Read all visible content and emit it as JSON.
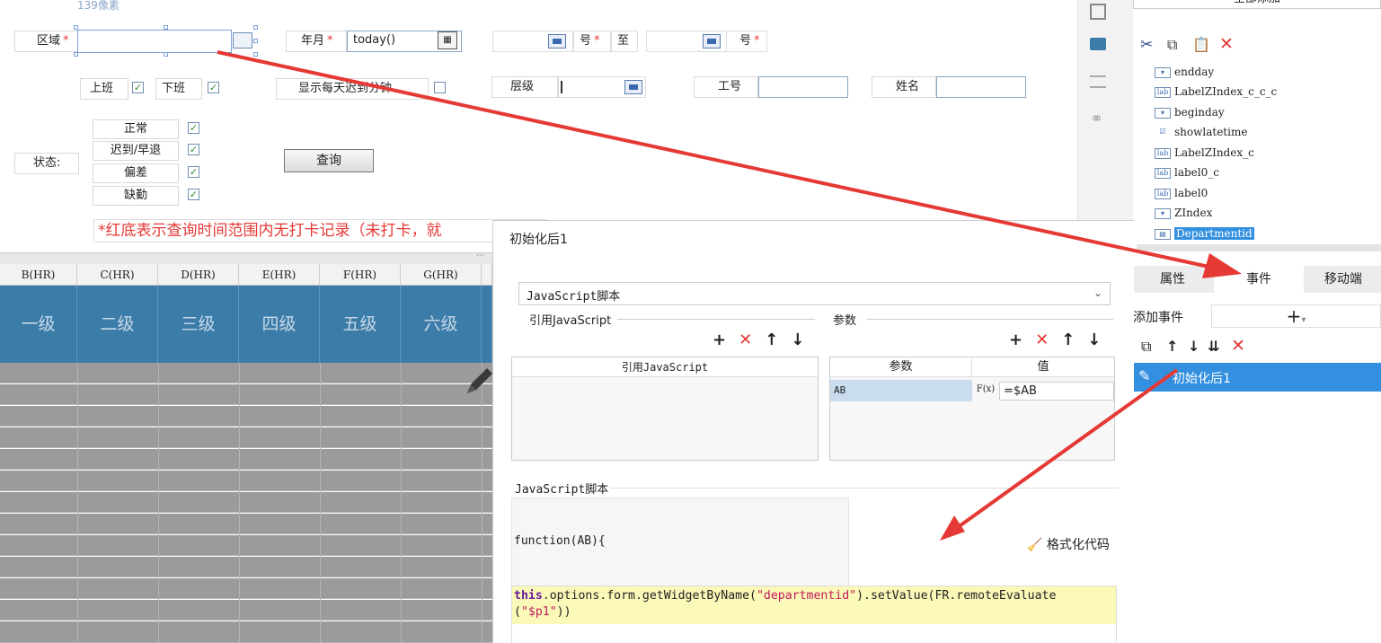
{
  "top_note": "139像素",
  "form": {
    "region_label": "区域",
    "yearmonth_label": "年月",
    "yearmonth_value": "today()",
    "day_label_1": "号",
    "to_label": "至",
    "day_label_2": "号",
    "req_mark": "*",
    "onduty_label": "上班",
    "offduty_label": "下班",
    "show_late_label": "显示每天迟到分钟",
    "level_label": "层级",
    "jobno_label": "工号",
    "name_label": "姓名",
    "status_label": "状态:",
    "status_items": [
      "正常",
      "迟到/早退",
      "偏差",
      "缺勤"
    ],
    "query_button": "查询",
    "red_note": "*红底表示查询时间范围内无打卡记录（未打卡，就"
  },
  "grid": {
    "col_headers": [
      "B(HR)",
      "C(HR)",
      "D(HR)",
      "E(HR)",
      "F(HR)",
      "G(HR)"
    ],
    "level_cells": [
      "一级",
      "二级",
      "三级",
      "四级",
      "五级",
      "六级"
    ]
  },
  "palette": {
    "add_all": "全部添加",
    "tree_items": [
      {
        "icon": "dropdown",
        "label": "endday"
      },
      {
        "icon": "lab",
        "label": "LabelZIndex_c_c_c"
      },
      {
        "icon": "dropdown",
        "label": "beginday"
      },
      {
        "icon": "check",
        "label": "showlatetime"
      },
      {
        "icon": "lab",
        "label": "LabelZIndex_c"
      },
      {
        "icon": "lab",
        "label": "label0_c"
      },
      {
        "icon": "lab",
        "label": "label0"
      },
      {
        "icon": "dropdown",
        "label": "ZIndex"
      },
      {
        "icon": "tree",
        "label": "Departmentid"
      }
    ],
    "tabs": [
      "属性",
      "事件",
      "移动端"
    ],
    "add_event_label": "添加事件",
    "event_item": "初始化后1"
  },
  "dialog": {
    "title": "初始化后1",
    "script_type": "JavaScript脚本",
    "ref_js_label": "引用JavaScript",
    "params_label": "参数",
    "ref_js_col": "引用JavaScript",
    "param_col": "参数",
    "value_col": "值",
    "param_name": "AB",
    "param_value": "=$AB",
    "fx_label": "F(x)",
    "script_section": "JavaScript脚本",
    "function_sig": "function(AB){",
    "format_code": "格式化代码",
    "code_this": "this",
    "code_mid": ".options.form.getWidgetByName(",
    "code_str1": "\"departmentid\"",
    "code_mid2": ").setValue(FR.remoteEvaluate",
    "code_line2_open": "(",
    "code_str2": "\"$p1\"",
    "code_line2_close": "))"
  },
  "colors": {
    "arrow": "#e53935",
    "header_blue": "#3c7ca8",
    "selected_blue": "#3390e0"
  }
}
